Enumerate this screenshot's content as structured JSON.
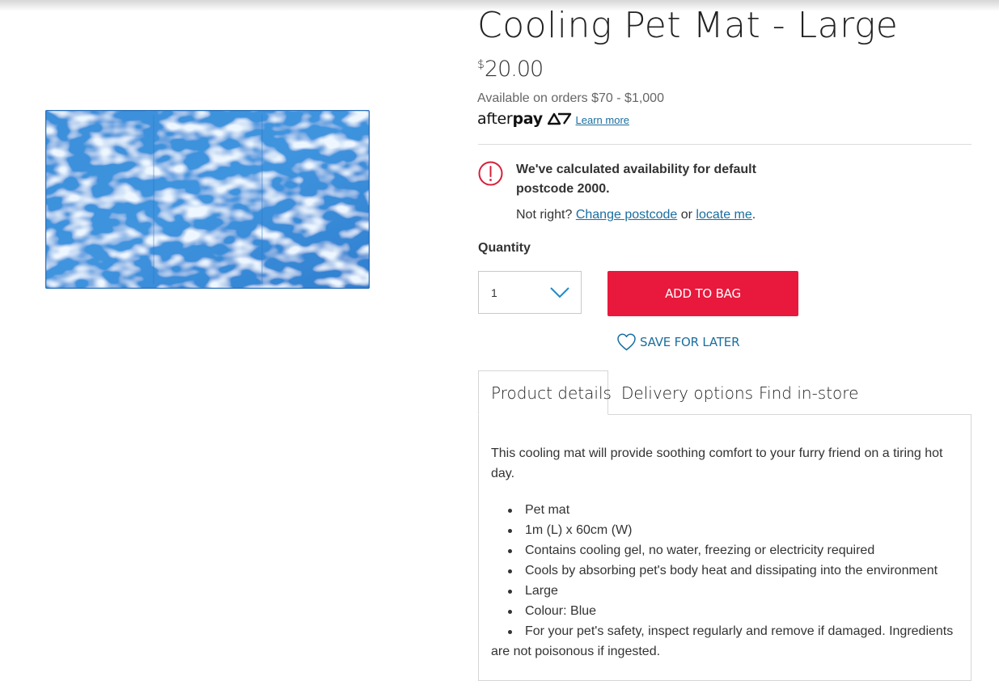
{
  "product": {
    "title": "Cooling Pet Mat - Large",
    "price_currency": "$",
    "price_amount": "20.00",
    "image_color": "#3a8bd6"
  },
  "afterpay": {
    "note": "Available on orders $70 - $1,000",
    "logo_text_light": "after",
    "logo_text_bold": "pay",
    "learn_more": "Learn more"
  },
  "availability": {
    "alert_icon": "exclamation-circle-icon",
    "message": "We've calculated availability for default postcode 2000.",
    "not_right_prefix": "Not right?",
    "change_postcode": "Change postcode",
    "or": "or",
    "locate_me": "locate me",
    "suffix": "."
  },
  "purchase": {
    "quantity_label": "Quantity",
    "quantity_value": "1",
    "add_to_bag": "ADD TO BAG",
    "save_for_later": "SAVE FOR LATER"
  },
  "tabs": [
    {
      "label": "Product details",
      "active": true
    },
    {
      "label": "Delivery options",
      "active": false
    },
    {
      "label": "Find in-store",
      "active": false
    }
  ],
  "details": {
    "description": "This cooling mat will provide soothing comfort to your furry friend on a tiring hot day.",
    "features": [
      "Pet mat",
      "1m (L) x 60cm (W)",
      "Contains cooling gel, no water, freezing or electricity required",
      "Cools by absorbing pet's body heat and dissipating into the environment",
      "Large",
      "Colour: Blue",
      "For your pet's safety, inspect regularly and remove if damaged. Ingredients are not poisonous if ingested."
    ]
  },
  "colors": {
    "accent_red": "#e8193c",
    "link_blue": "#1a6ea0",
    "chevron_blue": "#1f8ac9"
  }
}
